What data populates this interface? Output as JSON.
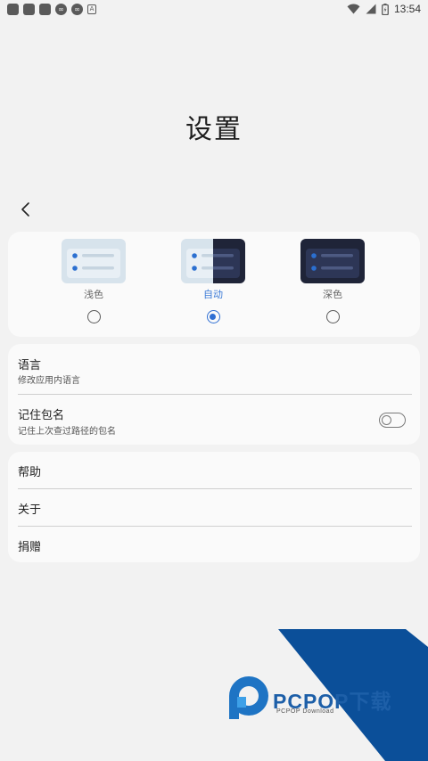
{
  "status_bar": {
    "time": "13:54",
    "left_icons": [
      "notification-square-icon",
      "notification-square-icon",
      "notification-square-icon",
      "infinity-icon",
      "infinity-icon",
      "a-icon"
    ],
    "right_icons": [
      "wifi-icon",
      "signal-icon",
      "battery-icon"
    ]
  },
  "page": {
    "title": "设置"
  },
  "theme": {
    "options": [
      {
        "label": "浅色",
        "selected": false,
        "preview": "light"
      },
      {
        "label": "自动",
        "selected": true,
        "preview": "auto"
      },
      {
        "label": "深色",
        "selected": false,
        "preview": "dark"
      }
    ],
    "accent": "#2f6fd3"
  },
  "settings": {
    "language": {
      "title": "语言",
      "subtitle": "修改应用内语言"
    },
    "remember_package": {
      "title": "记住包名",
      "subtitle": "记住上次查过路径的包名",
      "enabled": false
    }
  },
  "menu": {
    "help": "帮助",
    "about": "关于",
    "donate": "捐赠"
  },
  "watermark": {
    "brand": "PCPOP下载",
    "subtitle": "PCPOP Download"
  }
}
